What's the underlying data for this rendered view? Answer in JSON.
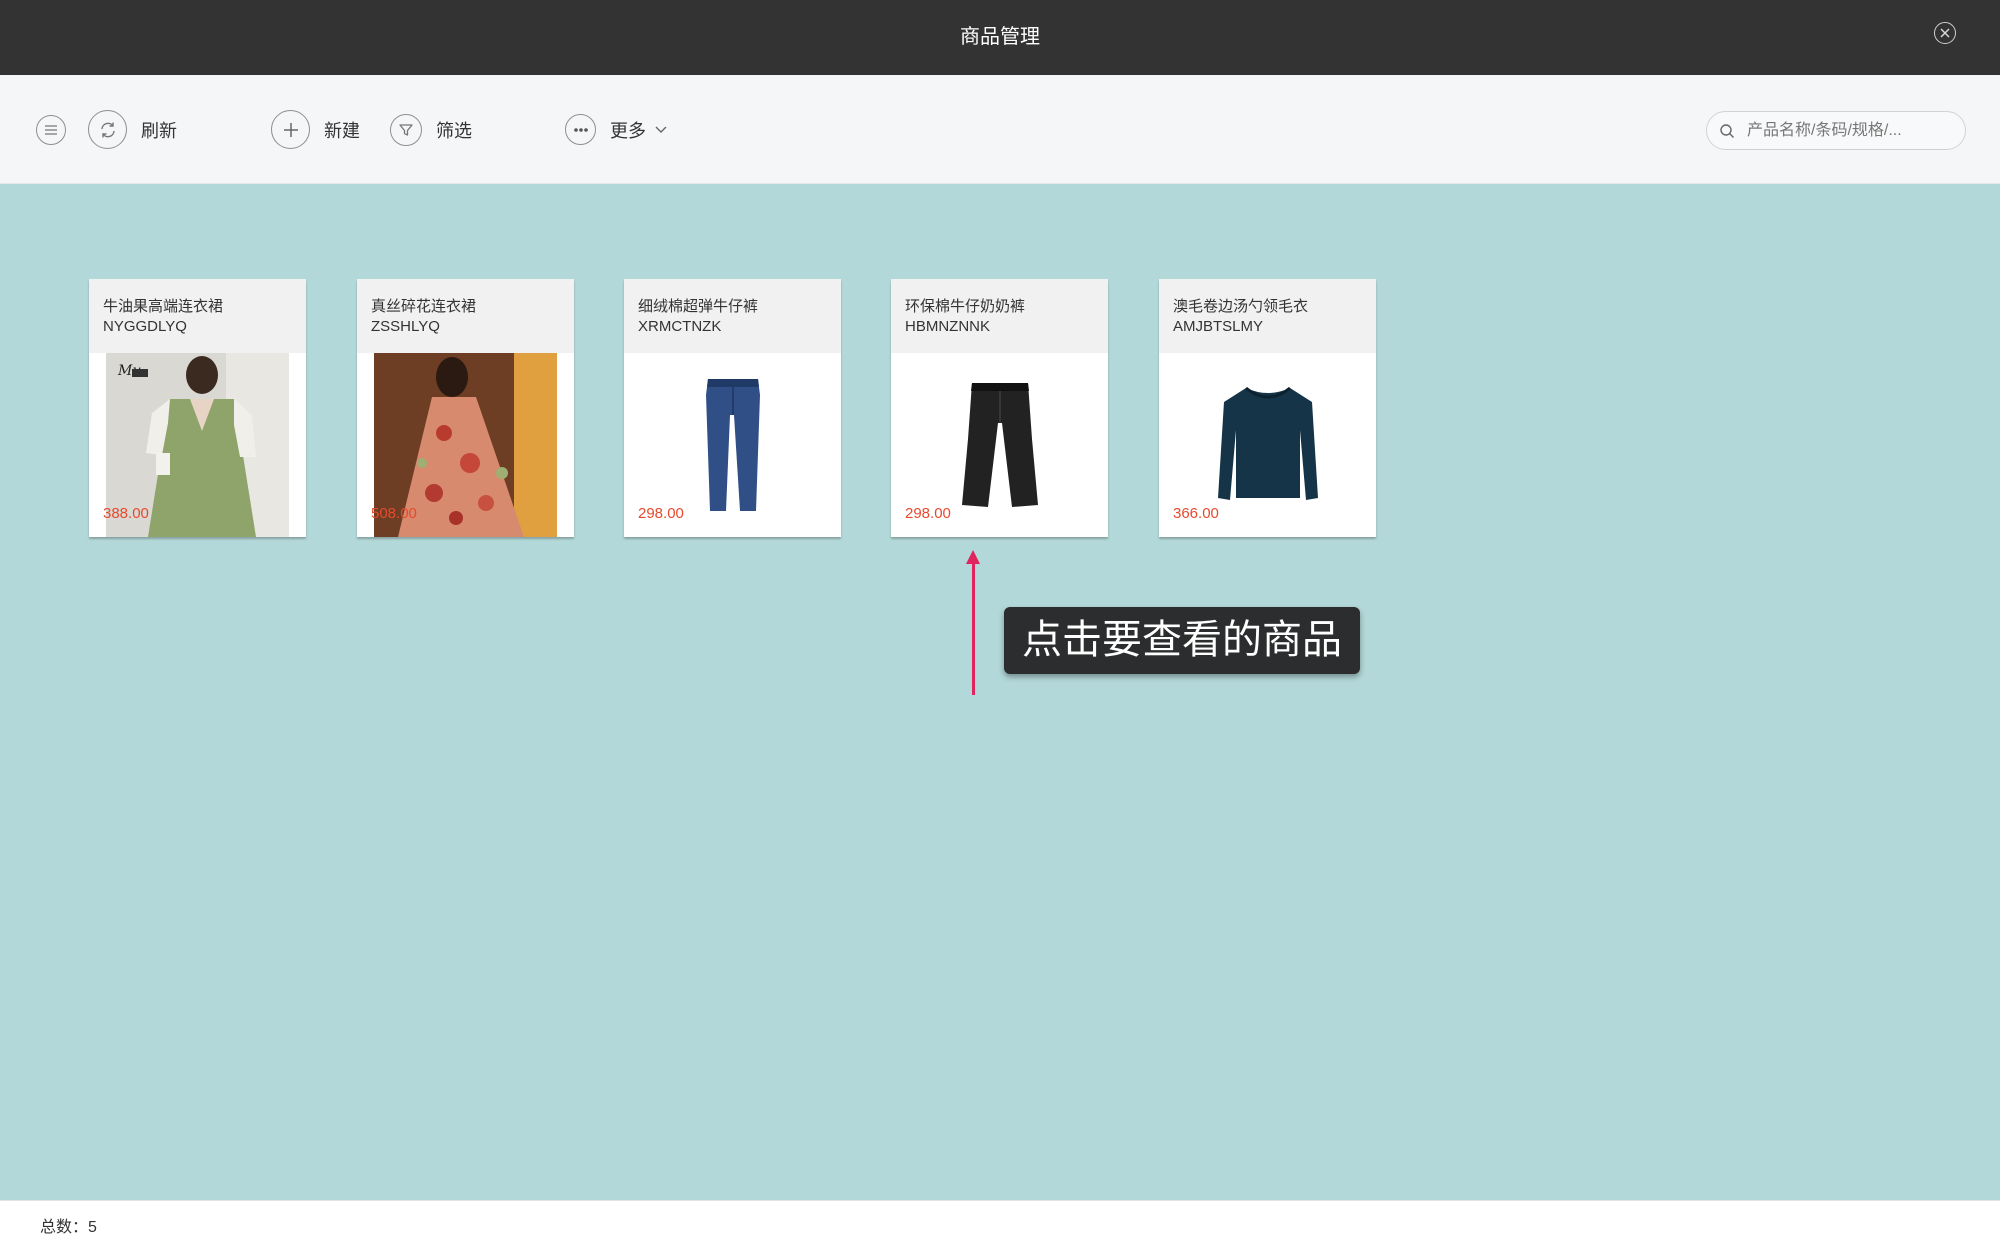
{
  "window": {
    "title": "商品管理",
    "close_icon": "close-icon"
  },
  "toolbar": {
    "menu_icon": "menu-icon",
    "refresh_label": "刷新",
    "new_label": "新建",
    "filter_label": "筛选",
    "more_label": "更多",
    "search_placeholder": "产品名称/条码/规格/..."
  },
  "products": [
    {
      "name": "牛油果高端连衣裙",
      "code": "NYGGDLYQ",
      "price": "388.00",
      "image": "green-dress-photo"
    },
    {
      "name": "真丝碎花连衣裙",
      "code": "ZSSHLYQ",
      "price": "508.00",
      "image": "floral-dress-photo"
    },
    {
      "name": "细绒棉超弹牛仔裤",
      "code": "XRMCTNZK",
      "price": "298.00",
      "image": "blue-jeans-photo"
    },
    {
      "name": "环保棉牛仔奶奶裤",
      "code": "HBMNZNNK",
      "price": "298.00",
      "image": "black-pants-photo"
    },
    {
      "name": "澳毛卷边汤勺领毛衣",
      "code": "AMJBTSLMY",
      "price": "366.00",
      "image": "navy-sweater-photo"
    }
  ],
  "hint": {
    "text": "点击要查看的商品"
  },
  "footer": {
    "total": "总数：5"
  },
  "colors": {
    "titlebar": "#333333",
    "background": "#b3d8d9",
    "price": "#e64a2e",
    "arrow": "#e0245e"
  }
}
